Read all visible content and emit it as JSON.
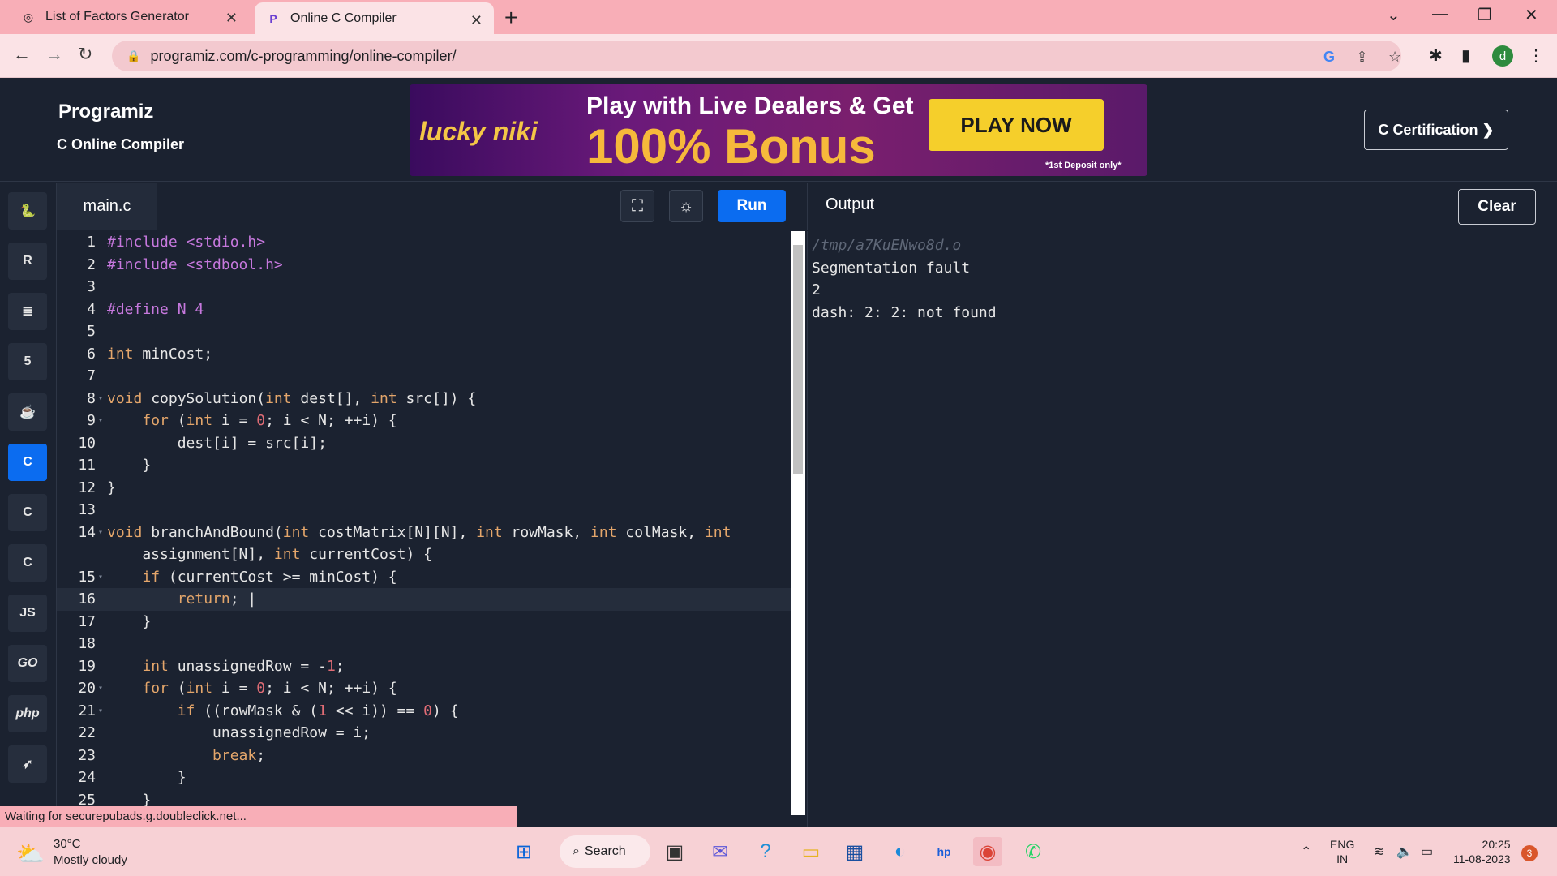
{
  "browser": {
    "tabs": [
      {
        "title": "List of Factors Generator",
        "close": "✕"
      },
      {
        "title": "Online C Compiler",
        "close": "✕"
      }
    ],
    "new_tab": "+",
    "url": "programiz.com/c-programming/online-compiler/"
  },
  "header": {
    "brand": "Programiz",
    "subtitle": "C Online Compiler",
    "ad": {
      "logo": "lucky niki",
      "line1": "Play with Live Dealers & Get",
      "line2": "100% Bonus",
      "button": "PLAY NOW",
      "note": "*1st Deposit only*"
    },
    "cert_button": "C Certification ❯"
  },
  "sidebar": {
    "languages": [
      {
        "name": "python",
        "glyph": "🐍"
      },
      {
        "name": "r",
        "glyph": "R"
      },
      {
        "name": "sql",
        "glyph": "≣"
      },
      {
        "name": "html",
        "glyph": "5"
      },
      {
        "name": "java",
        "glyph": "☕"
      },
      {
        "name": "c",
        "glyph": "C"
      },
      {
        "name": "cpp",
        "glyph": "C"
      },
      {
        "name": "csharp",
        "glyph": "C"
      },
      {
        "name": "js",
        "glyph": "JS"
      },
      {
        "name": "go",
        "glyph": "GO"
      },
      {
        "name": "php",
        "glyph": "php"
      },
      {
        "name": "swift",
        "glyph": "➶"
      }
    ],
    "active": "c"
  },
  "editor": {
    "file_tab": "main.c",
    "run_label": "Run",
    "lines": [
      {
        "n": "1",
        "code": "#include <stdio.h>"
      },
      {
        "n": "2",
        "code": "#include <stdbool.h>"
      },
      {
        "n": "3",
        "code": ""
      },
      {
        "n": "4",
        "code": "#define N 4"
      },
      {
        "n": "5",
        "code": ""
      },
      {
        "n": "6",
        "code": "int minCost;"
      },
      {
        "n": "7",
        "code": ""
      },
      {
        "n": "8",
        "code": "void copySolution(int dest[], int src[]) {"
      },
      {
        "n": "9",
        "code": "    for (int i = 0; i < N; ++i) {"
      },
      {
        "n": "10",
        "code": "        dest[i] = src[i];"
      },
      {
        "n": "11",
        "code": "    }"
      },
      {
        "n": "12",
        "code": "}"
      },
      {
        "n": "13",
        "code": ""
      },
      {
        "n": "14",
        "code": "void branchAndBound(int costMatrix[N][N], int rowMask, int colMask, int"
      },
      {
        "n": "",
        "code": "    assignment[N], int currentCost) {"
      },
      {
        "n": "15",
        "code": "    if (currentCost >= minCost) {"
      },
      {
        "n": "16",
        "code": "        return; |"
      },
      {
        "n": "17",
        "code": "    }"
      },
      {
        "n": "18",
        "code": ""
      },
      {
        "n": "19",
        "code": "    int unassignedRow = -1;"
      },
      {
        "n": "20",
        "code": "    for (int i = 0; i < N; ++i) {"
      },
      {
        "n": "21",
        "code": "        if ((rowMask & (1 << i)) == 0) {"
      },
      {
        "n": "22",
        "code": "            unassignedRow = i;"
      },
      {
        "n": "23",
        "code": "            break;"
      },
      {
        "n": "24",
        "code": "        }"
      },
      {
        "n": "25",
        "code": "    }"
      }
    ]
  },
  "output": {
    "title": "Output",
    "clear_label": "Clear",
    "lines": [
      "/tmp/a7KuENwo8d.o",
      "Segmentation fault",
      "2",
      "dash: 2: 2: not found"
    ]
  },
  "status_text": "Waiting for securepubads.g.doubleclick.net...",
  "taskbar": {
    "weather_temp": "30°C",
    "weather_desc": "Mostly cloudy",
    "search_label": "Search",
    "lang_line1": "ENG",
    "lang_line2": "IN",
    "time": "20:25",
    "date": "11-08-2023",
    "notifications": "3"
  }
}
